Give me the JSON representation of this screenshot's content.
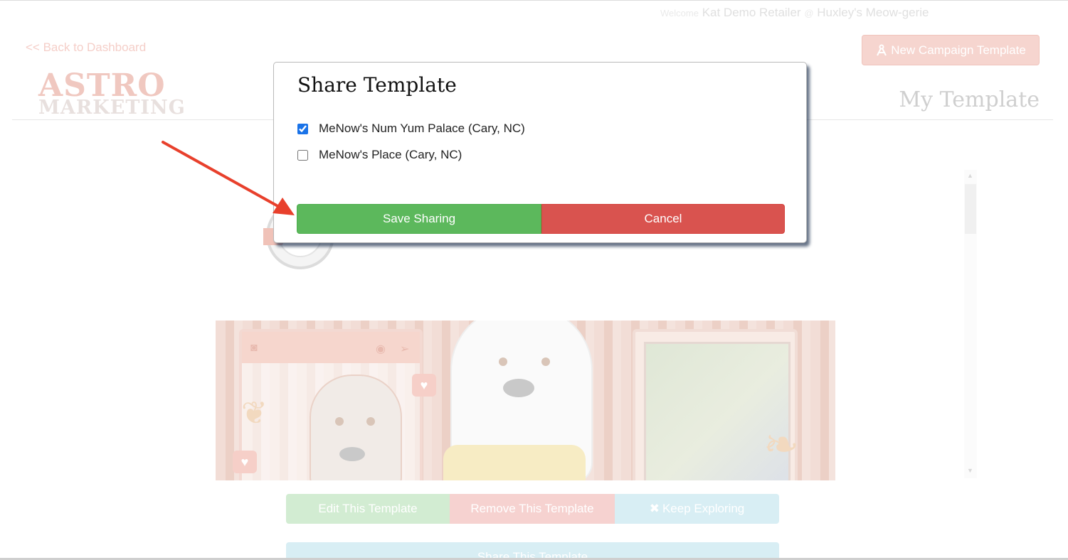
{
  "header": {
    "welcome_prefix": "Welcome",
    "user_name": "Kat Demo Retailer",
    "at_sign": "@",
    "store_name": "Huxley's Meow-gerie",
    "back_link": "<< Back to Dashboard",
    "new_campaign_button": "New Campaign Template",
    "new_campaign_icon": "compass-icon",
    "logo_line1": "ASTRO",
    "logo_line2": "MARKETING",
    "page_title": "My Template"
  },
  "modal": {
    "title": "Share Template",
    "options": [
      {
        "label": "MeNow's Num Yum Palace (Cary, NC)",
        "checked": true
      },
      {
        "label": "MeNow's Place (Cary, NC)",
        "checked": false
      }
    ],
    "save_button": "Save Sharing",
    "cancel_button": "Cancel"
  },
  "actions": {
    "edit": "Edit This Template",
    "remove": "Remove This Template",
    "keep_exploring": "Keep Exploring",
    "keep_icon": "close-icon",
    "share": "Share This Template"
  },
  "colors": {
    "save_green": "#5cb85c",
    "cancel_red": "#d9534f",
    "annotation_arrow": "#e8402c",
    "checkbox_blue": "#1a73e8"
  }
}
